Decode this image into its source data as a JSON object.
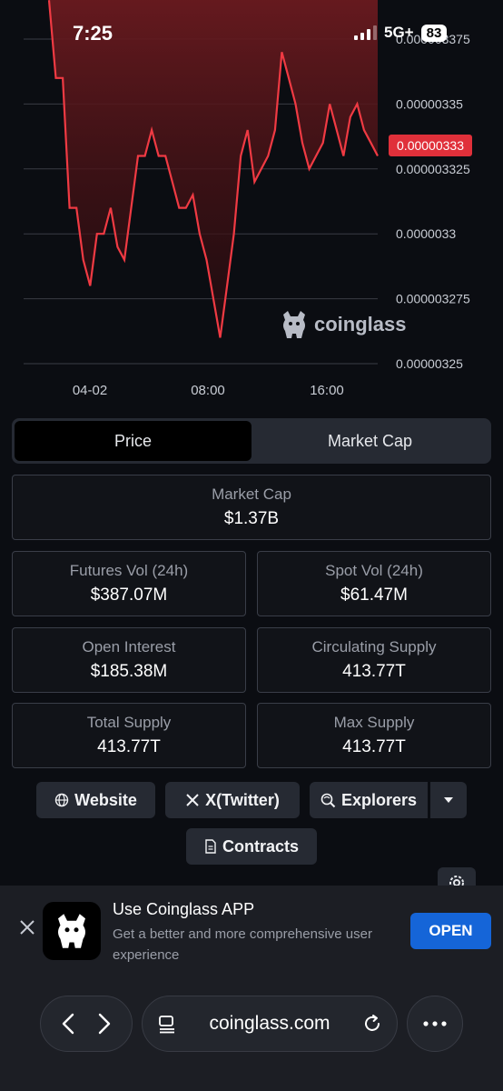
{
  "status_bar": {
    "time": "7:25",
    "network": "5G+",
    "battery": "83"
  },
  "chart_data": {
    "type": "area",
    "x_ticks": [
      "04-02",
      "08:00",
      "16:00"
    ],
    "y_ticks": [
      "0.00000335",
      "0.000003325",
      "0.0000033",
      "0.000003275",
      "0.00000325"
    ],
    "y_top_partial": "0.000003375",
    "ylim": [
      3.25e-06,
      3.375e-06
    ],
    "current_price": "0.00000333",
    "color": "#f03a43",
    "watermark": "coinglass",
    "values": [
      3.39e-06,
      3.36e-06,
      3.36e-06,
      3.31e-06,
      3.31e-06,
      3.29e-06,
      3.28e-06,
      3.3e-06,
      3.3e-06,
      3.31e-06,
      3.295e-06,
      3.29e-06,
      3.31e-06,
      3.33e-06,
      3.33e-06,
      3.34e-06,
      3.33e-06,
      3.33e-06,
      3.32e-06,
      3.31e-06,
      3.31e-06,
      3.315e-06,
      3.3e-06,
      3.29e-06,
      3.275e-06,
      3.26e-06,
      3.28e-06,
      3.3e-06,
      3.33e-06,
      3.34e-06,
      3.32e-06,
      3.325e-06,
      3.33e-06,
      3.34e-06,
      3.37e-06,
      3.36e-06,
      3.35e-06,
      3.335e-06,
      3.325e-06,
      3.33e-06,
      3.335e-06,
      3.35e-06,
      3.34e-06,
      3.33e-06,
      3.345e-06,
      3.35e-06,
      3.34e-06,
      3.335e-06,
      3.33e-06
    ]
  },
  "tabs": {
    "price": "Price",
    "market_cap": "Market Cap"
  },
  "stats": {
    "market_cap": {
      "label": "Market Cap",
      "value": "$1.37B"
    },
    "futures_vol": {
      "label": "Futures Vol (24h)",
      "value": "$387.07M"
    },
    "spot_vol": {
      "label": "Spot Vol (24h)",
      "value": "$61.47M"
    },
    "open_interest": {
      "label": "Open Interest",
      "value": "$185.38M"
    },
    "circulating_supply": {
      "label": "Circulating Supply",
      "value": "413.77T"
    },
    "total_supply": {
      "label": "Total Supply",
      "value": "413.77T"
    },
    "max_supply": {
      "label": "Max Supply",
      "value": "413.77T"
    }
  },
  "links": {
    "website": "Website",
    "twitter": "X(Twitter)",
    "explorers": "Explorers",
    "contracts": "Contracts"
  },
  "app_banner": {
    "title": "Use Coinglass APP",
    "subtitle": "Get a better and more comprehensive user experience",
    "open": "OPEN"
  },
  "browser": {
    "url": "coinglass.com"
  }
}
